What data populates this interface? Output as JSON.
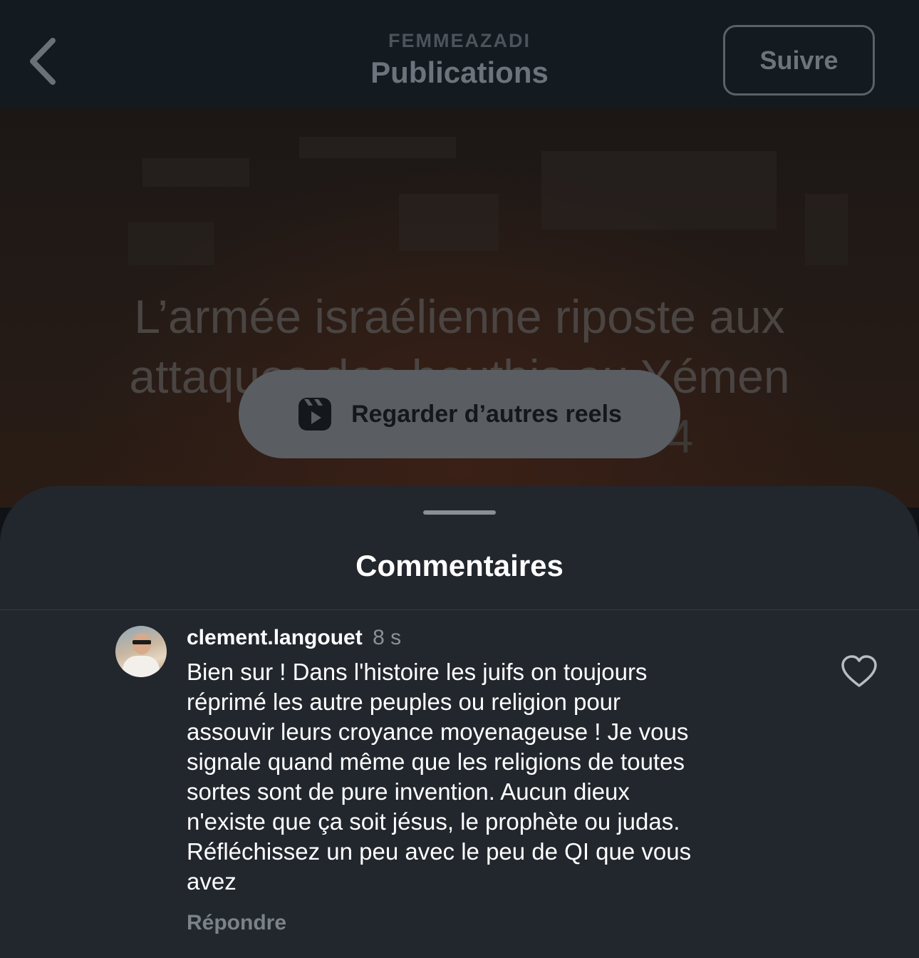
{
  "header": {
    "username": "FEMMEAZADI",
    "title": "Publications",
    "follow_label": "Suivre"
  },
  "video": {
    "caption_line1": "L’armée israélienne riposte aux",
    "caption_line2": "attaques des houthis au Yémen",
    "caption_line3": "4"
  },
  "reels_button": {
    "label": "Regarder d’autres reels"
  },
  "comments": {
    "title": "Commentaires",
    "items": [
      {
        "username": "clement.langouet",
        "time": "8 s",
        "text": "Bien sur ! Dans l'histoire les juifs on toujours\nréprimé les autre peuples ou religion pour\nassouvir leurs croyance moyenageuse ! Je vous\nsignale quand même que les religions de toutes\nsortes sont de pure invention. Aucun dieux\nn'existe  que ça soit jésus, le prophète ou judas.\nRéfléchissez un peu avec le peu de QI que vous\navez",
        "reply_label": "Répondre"
      }
    ]
  },
  "icons": {
    "back": "chevron-left-icon",
    "reels": "reels-icon",
    "like": "heart-icon"
  },
  "colors": {
    "sheet_bg": "#22272e",
    "topbar_bg": "#131a20",
    "reels_button_bg": "#5a5e62"
  }
}
